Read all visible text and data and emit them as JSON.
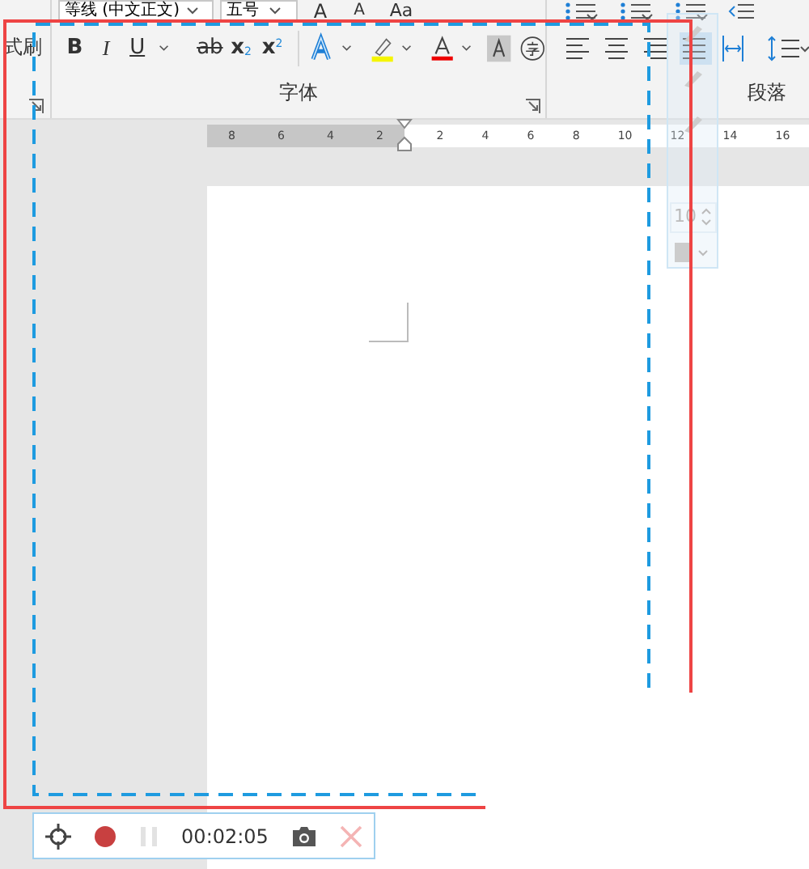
{
  "ribbon": {
    "font_name": "等线 (中文正文)",
    "font_size": "五号",
    "size_buttons": [
      "A",
      "A",
      "Aa"
    ],
    "clipboard_label": "式刷",
    "format_buttons": [
      {
        "kind": "bold",
        "label": "B"
      },
      {
        "kind": "italic",
        "label": "I"
      },
      {
        "kind": "underline",
        "label": "U"
      },
      {
        "kind": "strike",
        "label": "ab"
      },
      {
        "kind": "sub",
        "label": "x",
        "index": "2"
      },
      {
        "kind": "sup",
        "label": "x",
        "index": "2"
      }
    ],
    "font_group_label": "字体",
    "alignment": [
      {
        "selected": false
      },
      {
        "selected": false
      },
      {
        "selected": false
      },
      {
        "selected": true
      },
      {
        "selected": false
      }
    ],
    "paragraph_label": "段落"
  },
  "ruler": {
    "left_ticks": [
      "8",
      "6",
      "4",
      "2"
    ],
    "right_ticks": [
      "2",
      "4",
      "6",
      "8",
      "10",
      "12",
      "14",
      "16"
    ]
  },
  "mini_panel": {
    "spinner_value": "10"
  },
  "recorder": {
    "time": "00:02:05",
    "pause_disabled": true,
    "close_disabled": true
  }
}
